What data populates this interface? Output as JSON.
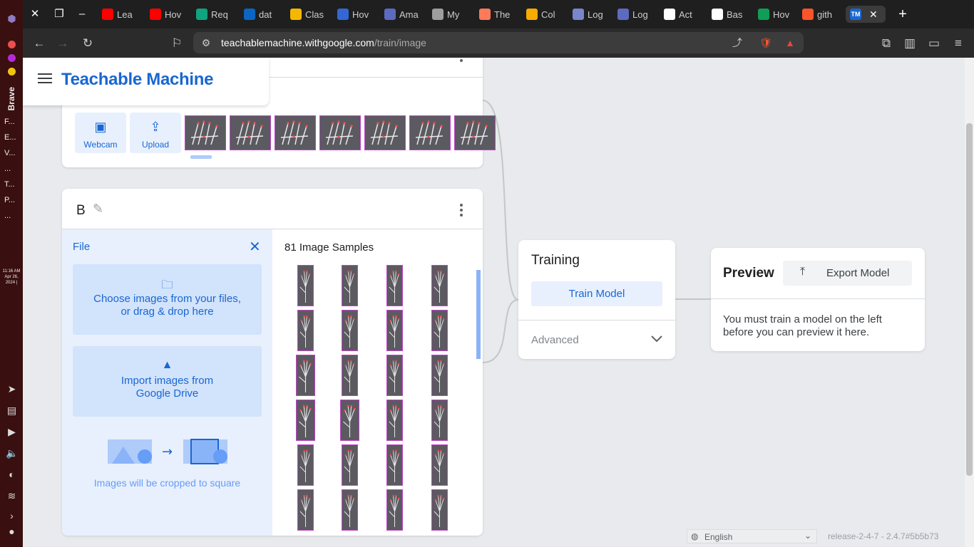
{
  "os_dock": {
    "browser_name": "Brave",
    "bookmarks": [
      "F...",
      "E...",
      "V...",
      "...",
      "T...",
      "P...",
      "..."
    ],
    "clock": {
      "time": "11:16 AM",
      "date": "Apr 26,",
      "year": "2024 |"
    }
  },
  "tabs": [
    {
      "label": "Lea",
      "icon": "youtube-icon",
      "color": "#ff0000"
    },
    {
      "label": "Hov",
      "icon": "youtube-icon",
      "color": "#ff0000"
    },
    {
      "label": "Req",
      "icon": "chatgpt-icon",
      "color": "#10a37f"
    },
    {
      "label": "dat",
      "icon": "linkedin-icon",
      "color": "#0a66c2"
    },
    {
      "label": "Clas",
      "icon": "studocu-icon",
      "color": "#f5b800"
    },
    {
      "label": "Hov",
      "icon": "c-icon",
      "color": "#3367d6"
    },
    {
      "label": "Ama",
      "icon": "app-icon",
      "color": "#5c6bc0"
    },
    {
      "label": "My",
      "icon": "globe-icon",
      "color": "#9e9e9e"
    },
    {
      "label": "The",
      "icon": "hubspot-icon",
      "color": "#ff7a59"
    },
    {
      "label": "Col",
      "icon": "colab-icon",
      "color": "#f9ab00"
    },
    {
      "label": "Log",
      "icon": "bicep-icon",
      "color": "#7986cb"
    },
    {
      "label": "Log",
      "icon": "grid-icon",
      "color": "#5c6bc0"
    },
    {
      "label": "Act",
      "icon": "github-icon",
      "color": "#ffffff"
    },
    {
      "label": "Bas",
      "icon": "github-icon",
      "color": "#ffffff"
    },
    {
      "label": "Hov",
      "icon": "sheets-icon",
      "color": "#0f9d58"
    },
    {
      "label": "gith",
      "icon": "brave-icon",
      "color": "#fb542b"
    }
  ],
  "active_tab": {
    "icon_text": "TM"
  },
  "address": {
    "host": "teachablemachine.withgoogle.com",
    "path": "/train/image",
    "shields_count": "4",
    "rewards_count": "1"
  },
  "app": {
    "title": "Teachable Machine"
  },
  "class_a": {
    "webcam_label": "Webcam",
    "upload_label": "Upload"
  },
  "class_b": {
    "name": "B",
    "file_panel": {
      "title": "File",
      "choose_files": "Choose images from your files, or drag & drop here",
      "choose_line1": "Choose images from your files,",
      "choose_line2": "or drag & drop here",
      "drive_line1": "Import images from",
      "drive_line2": "Google Drive",
      "crop_note": "Images will be cropped to square"
    },
    "samples_label": "81 Image Samples"
  },
  "training": {
    "title": "Training",
    "train_button": "Train Model",
    "advanced_label": "Advanced"
  },
  "preview": {
    "title": "Preview",
    "export_button": "Export Model",
    "message": "You must train a model on the left before you can preview it here."
  },
  "footer": {
    "language": "English",
    "release": "release-2-4-7 - 2.4.7#5b5b73"
  },
  "colors": {
    "accent": "#1967d2",
    "accent_light": "#e8f0fe",
    "sample_border": "#c044c8"
  }
}
